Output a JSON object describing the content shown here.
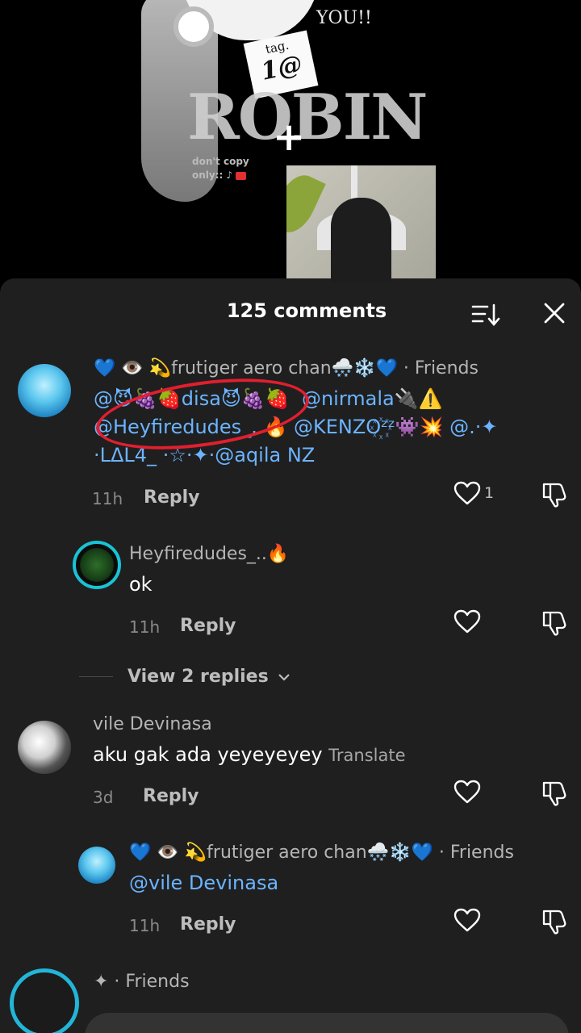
{
  "video": {
    "overlay_text": "YOU!!",
    "tag_note_line1": "tag.",
    "tag_note_line2": "1@",
    "title_text": "ROBIN",
    "dont_copy_line1": "don't copy",
    "dont_copy_line2": "only::"
  },
  "sheet": {
    "count_label": "125 comments",
    "sort_icon": "sort-icon",
    "close_icon": "close-icon"
  },
  "comments": [
    {
      "username": "💙 👁️ 💫frutiger aero chan🌨️❄️💙",
      "friends": " · Friends",
      "line1_a": "@😈🍇🍓disa😈🍇🍓",
      "line1_b": "@nirmala🔌⚠️",
      "line2_a": "@Heyfiredudes_..🔥",
      "line2_b": "@KENZO꙰ᶻᶻ👾💥",
      "line2_c": "@.·✦",
      "line3_a": "·LΔL4_ ·☆·✦·",
      "line3_b": "@aqila NZ",
      "time": "11h",
      "reply": "Reply",
      "likes": "1"
    },
    {
      "username": "Heyfiredudes_..🔥",
      "text": "ok",
      "time": "11h",
      "reply": "Reply"
    },
    {
      "view_replies": "View 2 replies"
    },
    {
      "username": "vile Devinasa",
      "text": "aku gak ada yeyeyeyey",
      "translate": "Translate",
      "time": "3d",
      "reply": "Reply"
    },
    {
      "username": "💙 👁️ 💫frutiger aero chan🌨️❄️💙",
      "friends": " · Friends",
      "mention": "@vile Devinasa",
      "time": "11h",
      "reply": "Reply"
    },
    {
      "username": "✦",
      "friends": " · Friends"
    }
  ],
  "colors": {
    "sheet_bg": "#1f1f1f",
    "mention": "#6cb4ff",
    "highlight_circle": "#e01f2f"
  }
}
